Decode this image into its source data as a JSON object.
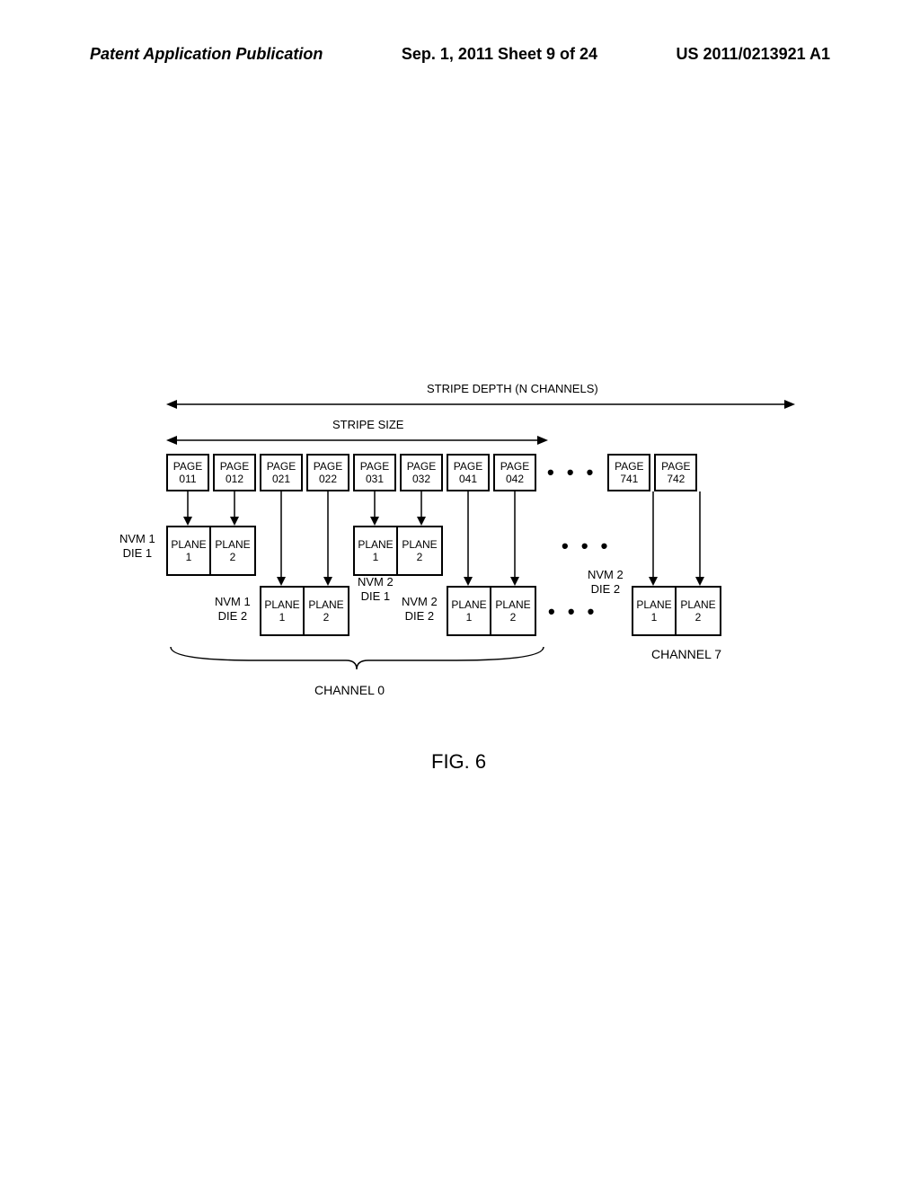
{
  "header": {
    "left": "Patent Application Publication",
    "center": "Sep. 1, 2011  Sheet 9 of 24",
    "right": "US 2011/0213921 A1"
  },
  "labels": {
    "stripe_depth": "STRIPE DEPTH (N CHANNELS)",
    "stripe_size": "STRIPE SIZE",
    "channel_0": "CHANNEL  0",
    "channel_7": "CHANNEL  7",
    "figure": "FIG. 6"
  },
  "pages": [
    {
      "top": "PAGE",
      "bottom": "011"
    },
    {
      "top": "PAGE",
      "bottom": "012"
    },
    {
      "top": "PAGE",
      "bottom": "021"
    },
    {
      "top": "PAGE",
      "bottom": "022"
    },
    {
      "top": "PAGE",
      "bottom": "031"
    },
    {
      "top": "PAGE",
      "bottom": "032"
    },
    {
      "top": "PAGE",
      "bottom": "041"
    },
    {
      "top": "PAGE",
      "bottom": "042"
    }
  ],
  "pages_tail": [
    {
      "top": "PAGE",
      "bottom": "741"
    },
    {
      "top": "PAGE",
      "bottom": "742"
    }
  ],
  "nvm_labels": {
    "nvm1_die1": {
      "line1": "NVM 1",
      "line2": "DIE 1"
    },
    "nvm1_die2": {
      "line1": "NVM 1",
      "line2": "DIE 2"
    },
    "nvm2_die1": {
      "line1": "NVM 2",
      "line2": "DIE 1"
    },
    "nvm2_die2": {
      "line1": "NVM 2",
      "line2": "DIE 2"
    },
    "nvm2_die2_tail": {
      "line1": "NVM 2",
      "line2": "DIE 2"
    }
  },
  "plane": {
    "name": "PLANE",
    "one": "1",
    "two": "2"
  },
  "ellipsis": "• • •"
}
